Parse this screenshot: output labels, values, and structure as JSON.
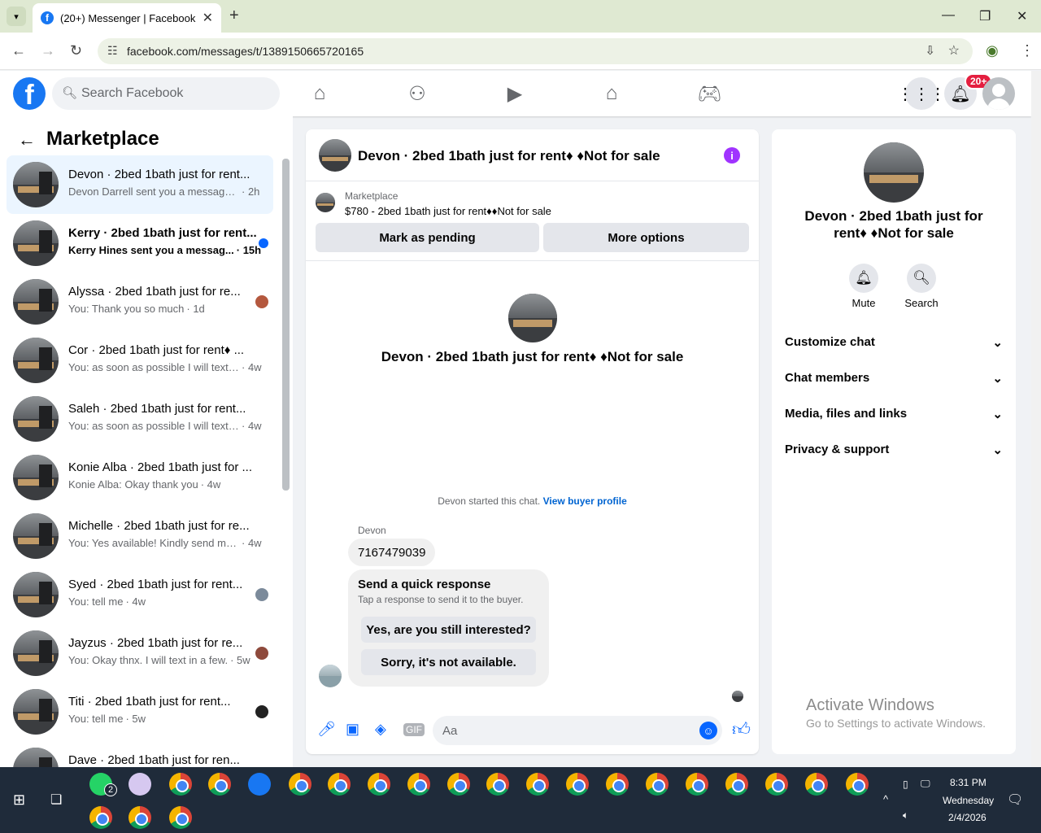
{
  "browser": {
    "tab_title": "(20+) Messenger | Facebook",
    "url": "facebook.com/messages/t/1389150665720165"
  },
  "header": {
    "search_placeholder": "Search Facebook",
    "notification_badge": "20+"
  },
  "left_panel": {
    "title": "Marketplace",
    "conversations": [
      {
        "name": "Devon · 2bed 1bath just for rent...",
        "message": "Devon Darrell sent you a message ...",
        "time": "· 2h",
        "unread": false
      },
      {
        "name": "Kerry · 2bed 1bath just for rent...",
        "message": "Kerry Hines sent you a messag...",
        "time": "· 15h",
        "unread": true
      },
      {
        "name": "Alyssa · 2bed 1bath just for re...",
        "message": "You: Thank you so much",
        "time": "· 1d",
        "unread": false
      },
      {
        "name": "Cor · 2bed 1bath just for rent♦ ...",
        "message": "You: as soon as possible I will text ...",
        "time": "· 4w",
        "unread": false
      },
      {
        "name": "Saleh · 2bed 1bath just for rent...",
        "message": "You: as soon as possible I will text ...",
        "time": "· 4w",
        "unread": false
      },
      {
        "name": "Konie Alba · 2bed 1bath just for ...",
        "message": "Konie Alba: Okay thank you",
        "time": "· 4w",
        "unread": false
      },
      {
        "name": "Michelle · 2bed 1bath just for re...",
        "message": "You: Yes available! Kindly send me ...",
        "time": "· 4w",
        "unread": false
      },
      {
        "name": "Syed · 2bed 1bath just for rent...",
        "message": "You: tell me",
        "time": "· 4w",
        "unread": false
      },
      {
        "name": "Jayzus · 2bed 1bath just for re...",
        "message": "You: Okay thnx. I will text in a few.",
        "time": "· 5w",
        "unread": false
      },
      {
        "name": "Titi · 2bed 1bath just for rent...",
        "message": "You: tell me",
        "time": "· 5w",
        "unread": false
      },
      {
        "name": "Dave · 2bed 1bath just for ren...",
        "message": "",
        "time": "",
        "unread": false
      }
    ]
  },
  "chat": {
    "title": "Devon · 2bed 1bath just for rent♦ ♦Not for sale",
    "marketplace_label": "Marketplace",
    "listing": "$780 - 2bed 1bath just for rent♦♦Not for sale",
    "mark_pending": "Mark as pending",
    "more_options": "More options",
    "center_name": "Devon · 2bed 1bath just for rent♦ ♦Not for sale",
    "started_text": "Devon started this chat.",
    "buyer_profile_link": "View buyer profile",
    "sender": "Devon",
    "message": "7167479039",
    "quick_title": "Send a quick response",
    "quick_sub": "Tap a response to send it to the buyer.",
    "quick_reply_1": "Yes, are you still interested?",
    "quick_reply_2": "Sorry, it's not available.",
    "composer_placeholder": "Aa"
  },
  "right_panel": {
    "name": "Devon · 2bed 1bath just for rent♦ ♦Not for sale",
    "mute": "Mute",
    "search": "Search",
    "sections": [
      "Customize chat",
      "Chat members",
      "Media, files and links",
      "Privacy & support"
    ],
    "activate_title": "Activate Windows",
    "activate_sub": "Go to Settings to activate Windows."
  },
  "taskbar": {
    "time": "8:31 PM",
    "day": "Wednesday",
    "date": "2/4/2026",
    "whatsapp_count": "2"
  },
  "colors": {
    "facebook_blue": "#1877f2",
    "messenger_blue": "#0866ff",
    "info_purple": "#a033ff",
    "badge_red": "#e41e3f",
    "active_conv_bg": "#ebf5ff"
  },
  "icons": [
    "facebook-icon",
    "search-icon",
    "home-icon",
    "friends-icon",
    "video-icon",
    "marketplace-icon",
    "gaming-icon",
    "menu-grid-icon",
    "bell-icon",
    "info-icon",
    "mic-icon",
    "image-icon",
    "sticker-icon",
    "gif-icon",
    "emoji-icon",
    "like-icon",
    "chevron-down-icon"
  ]
}
